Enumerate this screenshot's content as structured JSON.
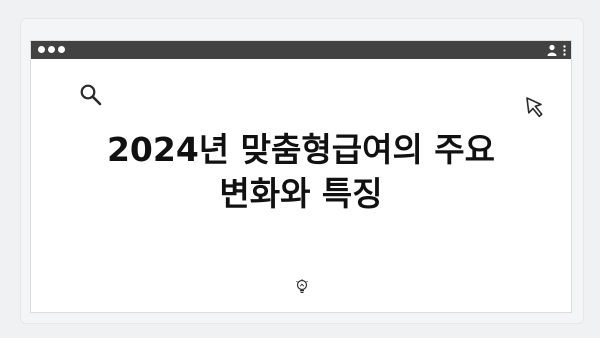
{
  "headline": {
    "line1": "2024년 맞춤형급여의 주요",
    "line2": "변화와 특징"
  },
  "icons": {
    "search": "search-icon",
    "cursor": "cursor-arrow-icon",
    "lightbulb": "lightbulb-icon",
    "profile": "profile-icon",
    "menu": "kebab-menu-icon"
  },
  "colors": {
    "titlebar": "#424242",
    "background": "#f0f1f3",
    "window": "#ffffff",
    "text": "#111111"
  }
}
